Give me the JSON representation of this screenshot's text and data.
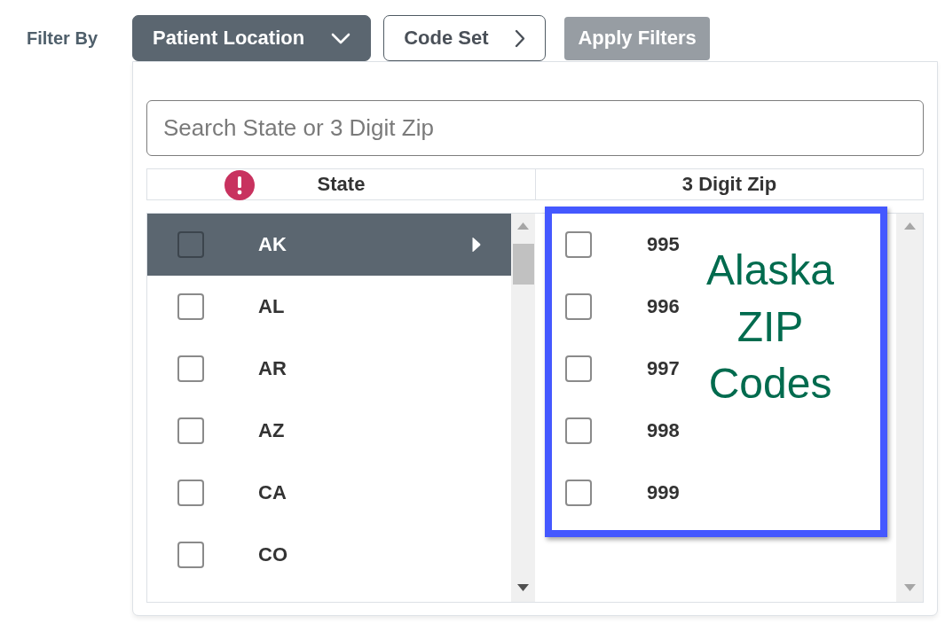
{
  "filter_bar": {
    "label": "Filter By",
    "tabs": [
      {
        "label": "Patient Location",
        "selected": true,
        "kind": "dropdown"
      },
      {
        "label": "Code Set",
        "selected": false,
        "kind": "step"
      }
    ],
    "apply_button": {
      "label": "Apply Filters",
      "disabled": true
    }
  },
  "panel": {
    "search": {
      "placeholder": "Search State or 3 Digit Zip"
    },
    "columns": [
      {
        "label": "State",
        "alert": true
      },
      {
        "label": "3 Digit Zip",
        "alert": false
      }
    ],
    "states": [
      {
        "code": "AK",
        "checked": false,
        "selected": true
      },
      {
        "code": "AL",
        "checked": false,
        "selected": false
      },
      {
        "code": "AR",
        "checked": false,
        "selected": false
      },
      {
        "code": "AZ",
        "checked": false,
        "selected": false
      },
      {
        "code": "CA",
        "checked": false,
        "selected": false
      },
      {
        "code": "CO",
        "checked": false,
        "selected": false
      }
    ],
    "zips": [
      {
        "code": "995",
        "checked": false
      },
      {
        "code": "996",
        "checked": false
      },
      {
        "code": "997",
        "checked": false
      },
      {
        "code": "998",
        "checked": false
      },
      {
        "code": "999",
        "checked": false
      }
    ]
  },
  "annotation": {
    "lines": [
      "Alaska",
      "ZIP",
      "Codes"
    ]
  }
}
